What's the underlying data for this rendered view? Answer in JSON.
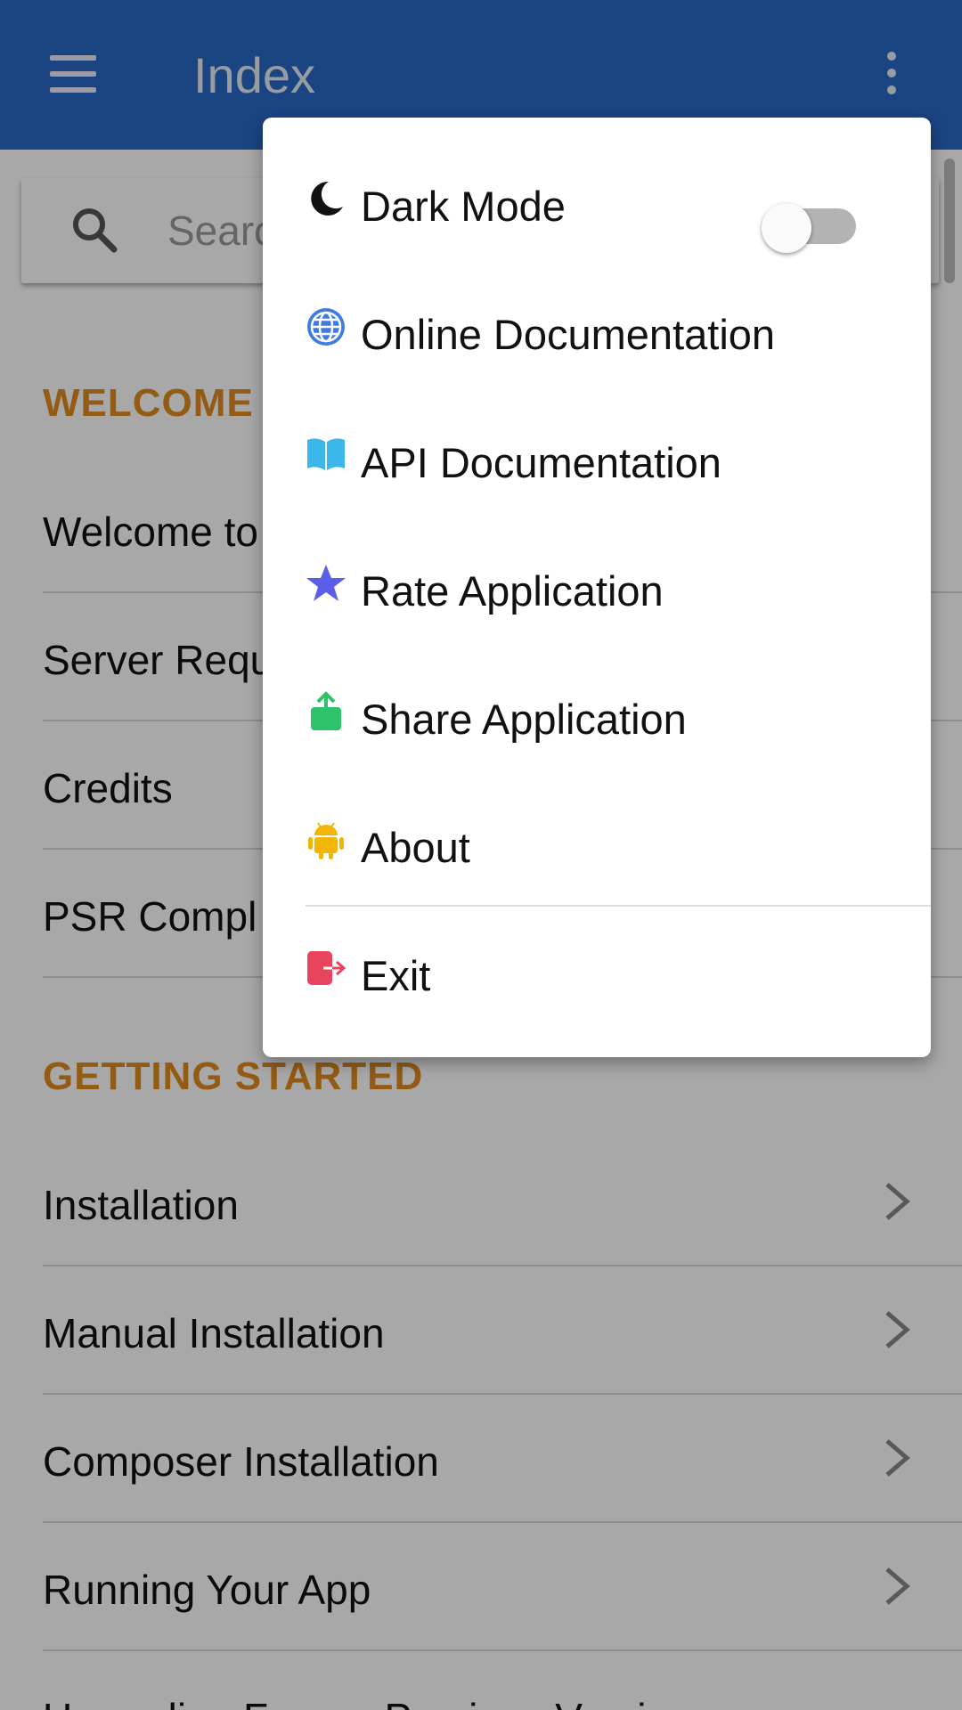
{
  "appbar": {
    "title": "Index"
  },
  "search": {
    "placeholder": "Search"
  },
  "sections": [
    {
      "title": "WELCOME",
      "items": [
        "Welcome to",
        "Server Requ",
        "Credits",
        "PSR Compl"
      ]
    },
    {
      "title": "GETTING STARTED",
      "items": [
        "Installation",
        "Manual Installation",
        "Composer Installation",
        "Running Your App",
        "Upgrading From a Previous Version"
      ]
    }
  ],
  "popup_menu": {
    "dark_mode": {
      "label": "Dark Mode",
      "enabled": false,
      "icon": "moon-icon"
    },
    "items": [
      {
        "label": "Online Documentation",
        "icon": "globe-icon",
        "color": "#3f7be0"
      },
      {
        "label": "API Documentation",
        "icon": "book-icon",
        "color": "#3cb7ea"
      },
      {
        "label": "Rate Application",
        "icon": "star-icon",
        "color": "#5b5fe8"
      },
      {
        "label": "Share Application",
        "icon": "share-icon",
        "color": "#2ec26a"
      },
      {
        "label": "About",
        "icon": "android-icon",
        "color": "#f2b705"
      }
    ],
    "exit": {
      "label": "Exit",
      "icon": "exit-icon",
      "color": "#e8445e"
    }
  },
  "colors": {
    "appbar": "#2a68c6",
    "section_title": "#e08a1e"
  }
}
